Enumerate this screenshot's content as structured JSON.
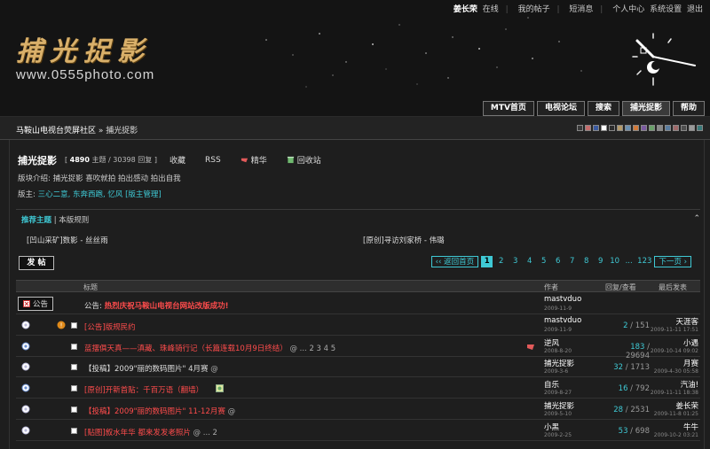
{
  "toplinks": {
    "user": "姜长荣",
    "status": "在线",
    "my_posts": "我的帖子",
    "messages": "短消息",
    "profile": "个人中心",
    "settings": "系统设置",
    "logout": "退出"
  },
  "logo": {
    "cn": "捕光捉影",
    "url": "www.0555photo.com"
  },
  "nav": [
    "MTV首页",
    "电视论坛",
    "搜索",
    "捕光捉影",
    "帮助"
  ],
  "breadcrumb": {
    "site": "马鞍山电视台荧屏社区",
    "sep": "»",
    "current": "捕光捉影"
  },
  "swatches": [
    "#3a3a3a",
    "#c56d6d",
    "#3a5aa0",
    "#ffffff",
    "#2c2c2c",
    "#b49a6a",
    "#6a8fb0",
    "#d27a3a",
    "#7b5aa0",
    "#6aa06a",
    "#888888",
    "#5a7da0",
    "#a06a6a",
    "#4f4f4f",
    "#9a9a9a",
    "#3a7a7a"
  ],
  "forum": {
    "title": "捕光捉影",
    "stats_open": "[",
    "topics": "4890",
    "topics_label": "主题",
    "sep": "/",
    "replies": "30398",
    "replies_label": "回复",
    "stats_close": "]",
    "favorite": "收藏",
    "rss": "RSS",
    "digest": "精华",
    "recycle": "回收站",
    "description": "版块介绍: 捕光捉影 喜吹就拍 拍出感动 拍出自我",
    "moderators_label": "版主:",
    "moderators": "三心二意, 东奔西跑, 忆风",
    "moderator_admin": "[版主管理]"
  },
  "recommend": {
    "tab_active": "推荐主题",
    "tab_sep": "|",
    "tab_other": "本版规则",
    "collapse": "⌃",
    "items": [
      "[凹山采矿]数影 - 丝丝雨",
      "[原创]寻访刘家桥 - 伟璐"
    ]
  },
  "post_button": "发 帖",
  "pager": {
    "prev": "‹‹ 返回首页",
    "pages": [
      "1",
      "2",
      "3",
      "4",
      "5",
      "6",
      "7",
      "8",
      "9",
      "10"
    ],
    "current": "1",
    "dots": "...",
    "last": "123",
    "next": "下一页 ›"
  },
  "table": {
    "col_title": "标题",
    "col_author": "作者",
    "col_counts": "回复/查看",
    "col_last": "最后发表",
    "rows": [
      {
        "kind": "announce",
        "label": "公告",
        "prefix": "公告:",
        "title": "热烈庆祝马鞍山电视台网站改版成功!",
        "color": "red",
        "author": "mastvduo",
        "adate": "2009-11-9",
        "replies": "",
        "views": "",
        "last": "",
        "ldate": ""
      },
      {
        "kind": "topic",
        "title": "[公告]版规民约",
        "color": "red",
        "extra": "",
        "author": "mastvduo",
        "adate": "2009-11-9",
        "replies": "2",
        "views": "151",
        "last": "天涯客",
        "ldate": "2009-11-11 17:51"
      },
      {
        "kind": "topic",
        "title": "蓝摆俱天真——滇藏、珠峰骑行记（长篇连载10月9日终结）",
        "color": "red",
        "extra": "@ ... 2 3 4 5",
        "author": "逆风",
        "adate": "2008-8-20",
        "replies": "183",
        "views": "29694",
        "last": "小遇",
        "ldate": "2009-10-14 09:02"
      },
      {
        "kind": "topic",
        "title": "【投稿】2009\"丽的数码图片\" 4月赛",
        "color": "white",
        "extra": "@",
        "author": "捕光捉影",
        "adate": "2009-3-6",
        "replies": "32",
        "views": "1713",
        "last": "月赛",
        "ldate": "2009-4-30 05:58"
      },
      {
        "kind": "topic",
        "title": "[原创]开新首贴：千百万语（翻墙）",
        "color": "red",
        "extra": "",
        "author": "自乐",
        "adate": "2009-8-27",
        "replies": "16",
        "views": "792",
        "last": "汽油!",
        "ldate": "2009-11-11 18:38"
      },
      {
        "kind": "topic",
        "title": "【投稿】2009\"丽的数码图片\" 11-12月赛",
        "color": "red",
        "extra": "@",
        "author": "捕光捉影",
        "adate": "2009-5-10",
        "replies": "28",
        "views": "2531",
        "last": "姜长荣",
        "ldate": "2009-11-8 01:25"
      },
      {
        "kind": "topic",
        "title": "[贴图]叙水年华 都来发发老照片",
        "color": "red",
        "extra": "@ ... 2",
        "author": "小黑",
        "adate": "2009-2-25",
        "replies": "53",
        "views": "698",
        "last": "牛牛",
        "ldate": "2009-10-2 03:21"
      }
    ]
  }
}
